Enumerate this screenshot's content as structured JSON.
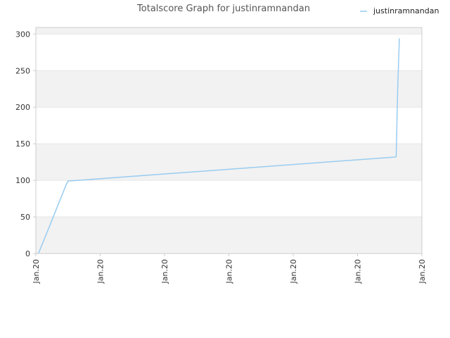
{
  "chart_data": {
    "type": "line",
    "title": "Totalscore Graph for justinramnandan",
    "xlabel": "",
    "ylabel": "",
    "ylim": [
      0,
      300
    ],
    "y_ticks": [
      0,
      50,
      100,
      150,
      200,
      250,
      300
    ],
    "x_tick_labels": [
      "Jan.20",
      "Jan.20",
      "Jan.20",
      "Jan.20",
      "Jan.20",
      "Jan.20",
      "Jan.20",
      "Jan.20",
      "Jan.20",
      "Jan.20",
      "Jan.20",
      "Jan.20",
      "Jan.20"
    ],
    "grid": true,
    "legend": "top-right",
    "colors": {
      "line": "#99ccf0",
      "band": "#f2f2f2",
      "grid": "#e6e6e6",
      "axis": "#cccccc"
    },
    "series": [
      {
        "name": "justinramnandan",
        "x": [
          0.08,
          0.45,
          0.95,
          1.0,
          11.2,
          11.25,
          11.3
        ],
        "y": [
          0,
          40,
          95,
          99,
          132,
          228,
          294
        ]
      }
    ]
  }
}
